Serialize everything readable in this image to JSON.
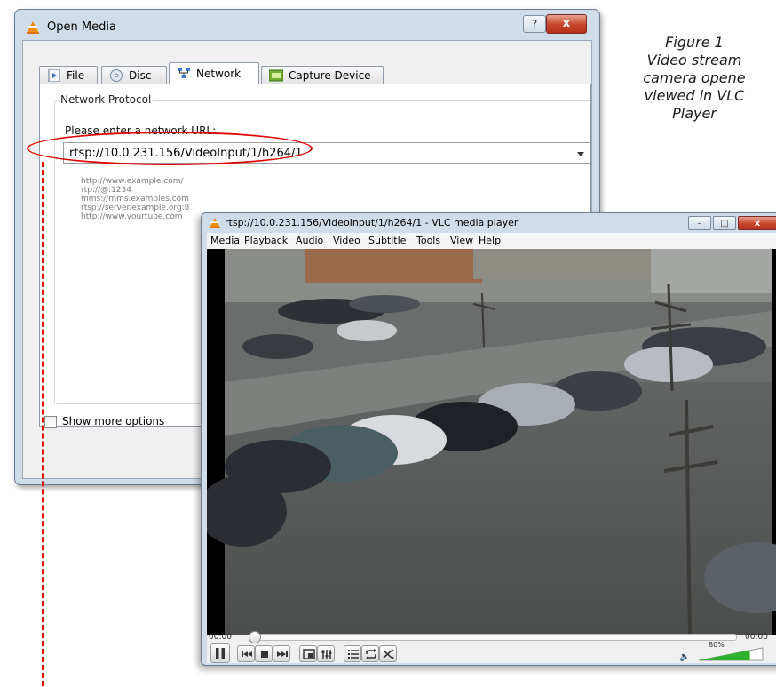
{
  "caption": {
    "lines": [
      "Figure 1",
      "Video stream",
      "camera opene",
      "viewed in VLC",
      "Player"
    ]
  },
  "open_media": {
    "title": "Open Media",
    "help_label": "?",
    "close_label": "x",
    "tabs": [
      {
        "label": "File",
        "icon": "file-icon",
        "active": false
      },
      {
        "label": "Disc",
        "icon": "disc-icon",
        "active": false
      },
      {
        "label": "Network",
        "icon": "network-icon",
        "active": true
      },
      {
        "label": "Capture Device",
        "icon": "capture-device-icon",
        "active": false
      }
    ],
    "group_label": "Network Protocol",
    "url_label": "Please enter a network URL:",
    "url_value": "rtsp://10.0.231.156/VideoInput/1/h264/1",
    "examples": [
      "http://www.example.com/",
      "rtp://@:1234",
      "mms://mms.examples.com",
      "rtsp://server.example.org:8",
      "http://www.yourtube.com"
    ],
    "show_more_options": "Show more options"
  },
  "vlc": {
    "title": "rtsp://10.0.231.156/VideoInput/1/h264/1 - VLC media player",
    "window_buttons": {
      "minimize": "–",
      "maximize": "□",
      "close": "x"
    },
    "menu": [
      "Media",
      "Playback",
      "Audio",
      "Video",
      "Subtitle",
      "Tools",
      "View",
      "Help"
    ],
    "time_elapsed": "00:00",
    "time_total": "00:00",
    "seek_position": 0,
    "volume_label": "80%",
    "volume_level": 0.8
  },
  "colors": {
    "annotation_red": "#e00000",
    "volume_green": "#2bb32b"
  }
}
